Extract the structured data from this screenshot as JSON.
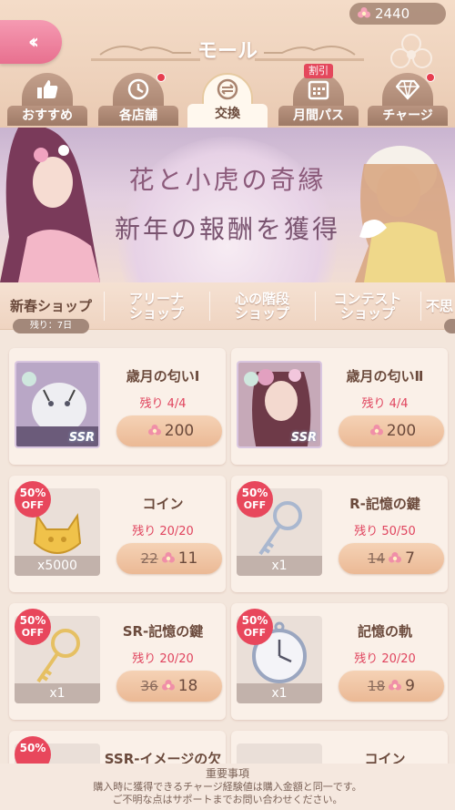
{
  "header": {
    "title": "モール",
    "back_icon": "double-chevron-left-icon",
    "currency": {
      "icon": "flower-gem-icon",
      "amount": "2440"
    }
  },
  "tabs": [
    {
      "label": "おすすめ",
      "icon": "thumbs-up-icon",
      "dot": false,
      "active": false
    },
    {
      "label": "各店舗",
      "icon": "shop-icon",
      "dot": true,
      "active": false
    },
    {
      "label": "交換",
      "icon": "exchange-icon",
      "dot": false,
      "active": true
    },
    {
      "label": "月間パス",
      "icon": "calendar-icon",
      "badge": "割引",
      "active": false
    },
    {
      "label": "チャージ",
      "icon": "diamond-icon",
      "dot": true,
      "active": false
    }
  ],
  "banner": {
    "line1": "花と小虎の奇縁",
    "line2": "新年の報酬を獲得"
  },
  "shop_tabs": [
    {
      "label": "新春ショップ",
      "active": true
    },
    {
      "label": "アリーナ\nショップ",
      "active": false
    },
    {
      "label": "心の階段\nショップ",
      "active": false
    },
    {
      "label": "コンテスト\nショップ",
      "active": false
    },
    {
      "label": "不思",
      "active": false
    }
  ],
  "remaining_time": "残り：7日",
  "items": [
    {
      "name": "歳月の匂いⅠ",
      "remain": "残り 4/4",
      "price": "200",
      "old_price": "",
      "discount": "",
      "rarity": "SSR",
      "qty": ""
    },
    {
      "name": "歳月の匂いⅡ",
      "remain": "残り 4/4",
      "price": "200",
      "old_price": "",
      "discount": "",
      "rarity": "SSR",
      "qty": ""
    },
    {
      "name": "コイン",
      "remain": "残り 20/20",
      "price": "11",
      "old_price": "22",
      "discount": "50%",
      "rarity": "",
      "qty": "x5000"
    },
    {
      "name": "R-記憶の鍵",
      "remain": "残り 50/50",
      "price": "7",
      "old_price": "14",
      "discount": "50%",
      "rarity": "",
      "qty": "x1"
    },
    {
      "name": "SR-記憶の鍵",
      "remain": "残り 20/20",
      "price": "18",
      "old_price": "36",
      "discount": "50%",
      "rarity": "",
      "qty": "x1"
    },
    {
      "name": "記憶の軌",
      "remain": "残り 20/20",
      "price": "9",
      "old_price": "18",
      "discount": "50%",
      "rarity": "",
      "qty": "x1"
    },
    {
      "name": "SSR-イメージの欠片",
      "remain": "",
      "price": "",
      "old_price": "",
      "discount": "50%",
      "rarity": "",
      "qty": ""
    },
    {
      "name": "コイン",
      "remain": "",
      "price": "",
      "old_price": "",
      "discount": "",
      "rarity": "",
      "qty": ""
    }
  ],
  "off_label": "OFF",
  "footer": {
    "title": "重要事項",
    "line1": "購入時に獲得できるチャージ経験値は購入金額と同一です。",
    "line2": "ご不明な点はサポートまでお問い合わせください。"
  },
  "colors": {
    "accent_pink": "#e8708f",
    "price_red": "#e0445e",
    "badge_red": "#e8475c"
  }
}
